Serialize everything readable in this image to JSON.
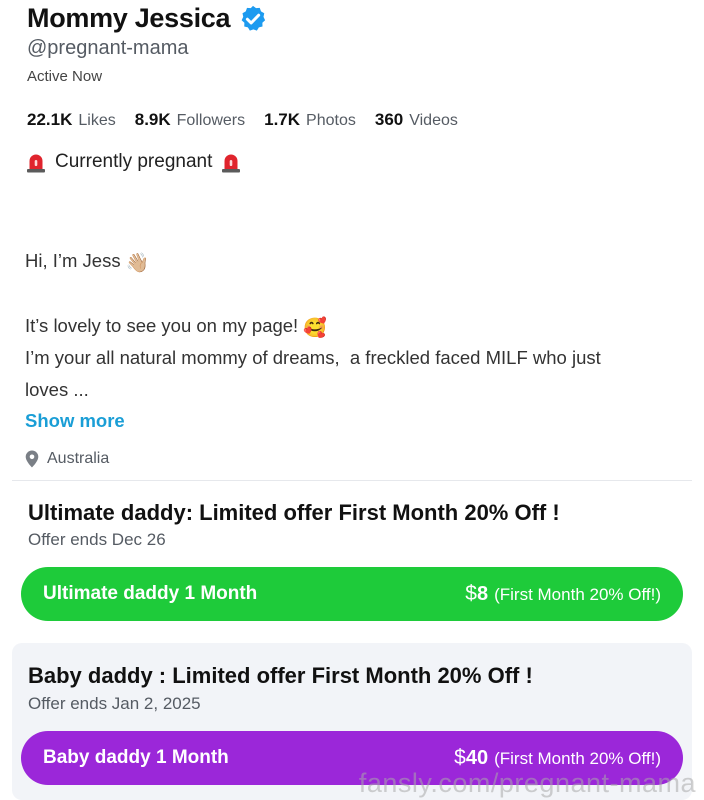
{
  "profile": {
    "name": "Mommy Jessica",
    "handle": "@pregnant-mama",
    "status": "Active Now"
  },
  "stats": [
    {
      "value": "22.1K",
      "label": "Likes"
    },
    {
      "value": "8.9K",
      "label": "Followers"
    },
    {
      "value": "1.7K",
      "label": "Photos"
    },
    {
      "value": "360",
      "label": "Videos"
    }
  ],
  "tagline": "Currently pregnant",
  "bio": {
    "line1": "Hi, I’m Jess",
    "line1_emoji": "👋🏼",
    "line2": "It’s lovely to see you on my page!",
    "line2_emoji": "🥰",
    "line3": "I’m your all natural mommy of dreams,  a freckled faced MILF who just",
    "line4": "loves ...",
    "show_more": "Show more"
  },
  "location": "Australia",
  "offers": [
    {
      "title": "Ultimate daddy: Limited offer First Month 20% Off !",
      "ends": "Offer ends Dec 26",
      "button_label": "Ultimate daddy 1 Month",
      "currency": "$",
      "price": "8",
      "price_note": "(First Month 20% Off!)",
      "color": "#1ecb3a"
    },
    {
      "title": "Baby daddy : Limited offer First Month 20% Off !",
      "ends": "Offer ends Jan 2, 2025",
      "button_label": "Baby daddy 1 Month",
      "currency": "$",
      "price": "40",
      "price_note": "(First Month 20% Off!)",
      "color": "#9b27d9"
    }
  ],
  "watermark": "fansly.com/pregnant-mama",
  "colors": {
    "link": "#1a9ed6",
    "verified": "#1d9bf0"
  }
}
